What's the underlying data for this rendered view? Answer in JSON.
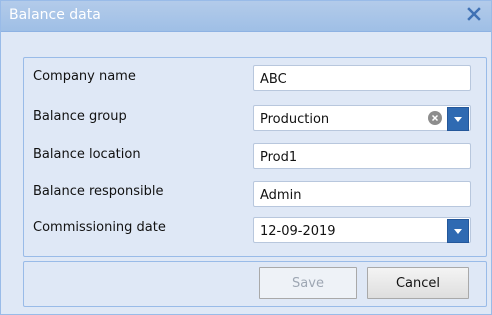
{
  "dialog": {
    "title": "Balance data"
  },
  "form": {
    "company_name": {
      "label": "Company name",
      "value": "ABC"
    },
    "balance_group": {
      "label": "Balance group",
      "value": "Production"
    },
    "balance_location": {
      "label": "Balance location",
      "value": "Prod1"
    },
    "balance_responsible": {
      "label": "Balance responsible",
      "value": "Admin"
    },
    "commissioning_date": {
      "label": "Commissioning date",
      "value": "12-09-2019"
    }
  },
  "buttons": {
    "save": "Save",
    "cancel": "Cancel"
  },
  "colors": {
    "dialog_bg": "#dfe8f6",
    "title_bar": "#9fbfe6",
    "combo_button": "#2f6ab2"
  },
  "icons": {
    "close": "close-icon",
    "clear": "clear-icon",
    "dropdown": "chevron-down-icon"
  }
}
